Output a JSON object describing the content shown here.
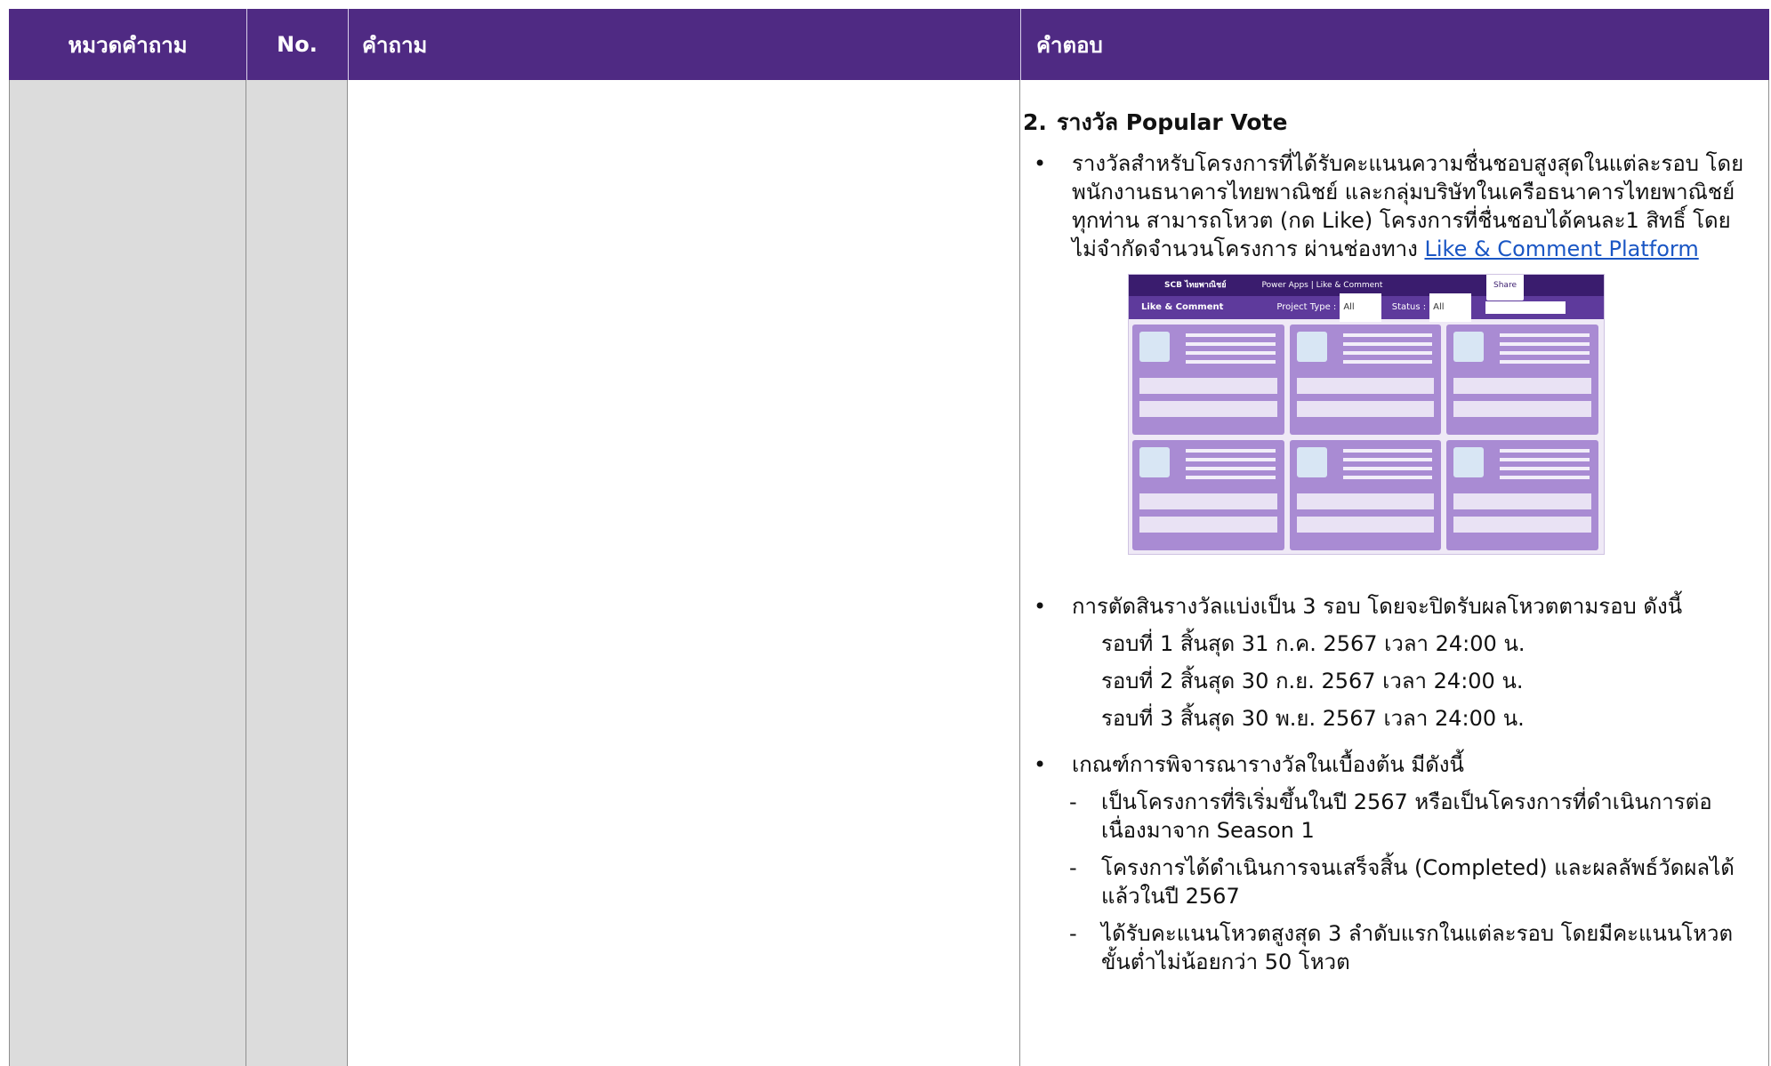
{
  "header": {
    "category": "หมวดคำถาม",
    "no": "No.",
    "question": "คำถาม",
    "answer": "คำตอบ"
  },
  "answer": {
    "section_number": "2.",
    "section_title": "รางวัล Popular Vote",
    "bullet1_text": "รางวัลสำหรับโครงการที่ได้รับคะแนนความชื่นชอบสูงสุดในแต่ละรอบ โดยพนักงานธนาคารไทยพาณิชย์ และกลุ่มบริษัทในเครือธนาคารไทยพาณิชย์ทุกท่าน สามารถโหวต (กด Like) โครงการที่ชื่นชอบได้คนละ1 สิทธิ์ โดยไม่จำกัดจำนวนโครงการ ผ่านช่องทาง",
    "bullet1_link": "Like & Comment Platform",
    "bullet2_text": "การตัดสินรางวัลแบ่งเป็น 3 รอบ โดยจะปิดรับผลโหวตตามรอบ ดังนี้",
    "rounds": [
      "รอบที่ 1 สิ้นสุด 31 ก.ค. 2567 เวลา 24:00 น.",
      "รอบที่ 2 สิ้นสุด 30 ก.ย. 2567 เวลา 24:00 น.",
      "รอบที่ 3 สิ้นสุด 30 พ.ย. 2567 เวลา 24:00 น."
    ],
    "bullet3_text": "เกณฑ์การพิจารณารางวัลในเบื้องต้น มีดังนี้",
    "criteria": [
      "เป็นโครงการที่ริเริ่มขึ้นในปี 2567 หรือเป็นโครงการที่ดำเนินการต่อเนื่องมาจาก Season 1",
      "โครงการได้ดำเนินการจนเสร็จสิ้น (Completed) และผลลัพธ์วัดผลได้แล้วในปี 2567",
      "ได้รับคะแนนโหวตสูงสุด 3 ลำดับแรกในแต่ละรอบ โดยมีคะแนนโหวตขั้นต่ำไม่น้อยกว่า 50 โหวต"
    ]
  },
  "screenshot": {
    "brand": "SCB ไทยพาณิชย์",
    "app_title": "Power Apps | Like & Comment",
    "share": "Share",
    "page_title": "Like & Comment",
    "project_type_label": "Project Type :",
    "status_label": "Status :",
    "all": "All"
  },
  "colors": {
    "header_bg": "#4f2a83",
    "gray_cell": "#dcdcdc",
    "link": "#1a56c4",
    "card": "#a98bd3"
  }
}
